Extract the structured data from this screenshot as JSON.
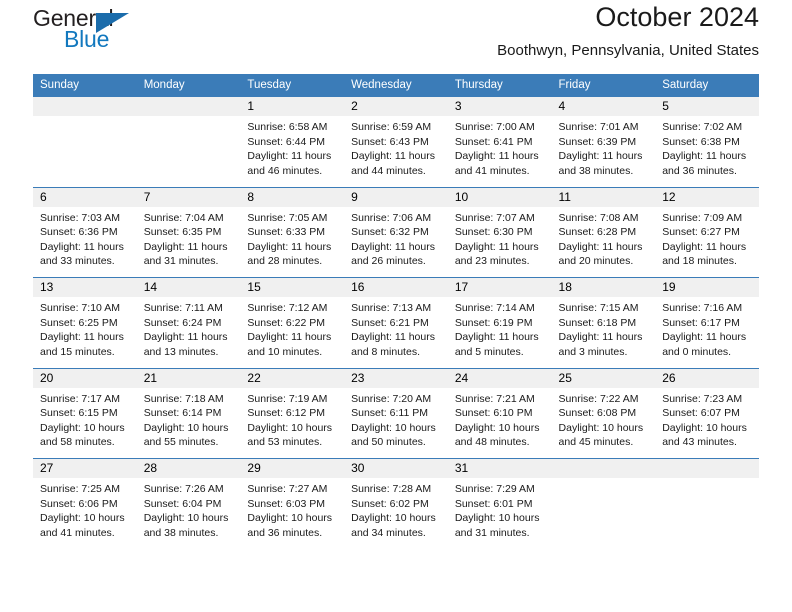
{
  "brand": {
    "name_primary": "General",
    "name_secondary": "Blue",
    "logo_icon": "triangle-icon"
  },
  "header": {
    "title": "October 2024",
    "subtitle": "Boothwyn, Pennsylvania, United States"
  },
  "calendar": {
    "weekday_headers": [
      "Sunday",
      "Monday",
      "Tuesday",
      "Wednesday",
      "Thursday",
      "Friday",
      "Saturday"
    ],
    "weeks": [
      [
        {
          "day": "",
          "sunrise": "",
          "sunset": "",
          "daylight_line1": "",
          "daylight_line2": ""
        },
        {
          "day": "",
          "sunrise": "",
          "sunset": "",
          "daylight_line1": "",
          "daylight_line2": ""
        },
        {
          "day": "1",
          "sunrise": "Sunrise: 6:58 AM",
          "sunset": "Sunset: 6:44 PM",
          "daylight_line1": "Daylight: 11 hours",
          "daylight_line2": "and 46 minutes."
        },
        {
          "day": "2",
          "sunrise": "Sunrise: 6:59 AM",
          "sunset": "Sunset: 6:43 PM",
          "daylight_line1": "Daylight: 11 hours",
          "daylight_line2": "and 44 minutes."
        },
        {
          "day": "3",
          "sunrise": "Sunrise: 7:00 AM",
          "sunset": "Sunset: 6:41 PM",
          "daylight_line1": "Daylight: 11 hours",
          "daylight_line2": "and 41 minutes."
        },
        {
          "day": "4",
          "sunrise": "Sunrise: 7:01 AM",
          "sunset": "Sunset: 6:39 PM",
          "daylight_line1": "Daylight: 11 hours",
          "daylight_line2": "and 38 minutes."
        },
        {
          "day": "5",
          "sunrise": "Sunrise: 7:02 AM",
          "sunset": "Sunset: 6:38 PM",
          "daylight_line1": "Daylight: 11 hours",
          "daylight_line2": "and 36 minutes."
        }
      ],
      [
        {
          "day": "6",
          "sunrise": "Sunrise: 7:03 AM",
          "sunset": "Sunset: 6:36 PM",
          "daylight_line1": "Daylight: 11 hours",
          "daylight_line2": "and 33 minutes."
        },
        {
          "day": "7",
          "sunrise": "Sunrise: 7:04 AM",
          "sunset": "Sunset: 6:35 PM",
          "daylight_line1": "Daylight: 11 hours",
          "daylight_line2": "and 31 minutes."
        },
        {
          "day": "8",
          "sunrise": "Sunrise: 7:05 AM",
          "sunset": "Sunset: 6:33 PM",
          "daylight_line1": "Daylight: 11 hours",
          "daylight_line2": "and 28 minutes."
        },
        {
          "day": "9",
          "sunrise": "Sunrise: 7:06 AM",
          "sunset": "Sunset: 6:32 PM",
          "daylight_line1": "Daylight: 11 hours",
          "daylight_line2": "and 26 minutes."
        },
        {
          "day": "10",
          "sunrise": "Sunrise: 7:07 AM",
          "sunset": "Sunset: 6:30 PM",
          "daylight_line1": "Daylight: 11 hours",
          "daylight_line2": "and 23 minutes."
        },
        {
          "day": "11",
          "sunrise": "Sunrise: 7:08 AM",
          "sunset": "Sunset: 6:28 PM",
          "daylight_line1": "Daylight: 11 hours",
          "daylight_line2": "and 20 minutes."
        },
        {
          "day": "12",
          "sunrise": "Sunrise: 7:09 AM",
          "sunset": "Sunset: 6:27 PM",
          "daylight_line1": "Daylight: 11 hours",
          "daylight_line2": "and 18 minutes."
        }
      ],
      [
        {
          "day": "13",
          "sunrise": "Sunrise: 7:10 AM",
          "sunset": "Sunset: 6:25 PM",
          "daylight_line1": "Daylight: 11 hours",
          "daylight_line2": "and 15 minutes."
        },
        {
          "day": "14",
          "sunrise": "Sunrise: 7:11 AM",
          "sunset": "Sunset: 6:24 PM",
          "daylight_line1": "Daylight: 11 hours",
          "daylight_line2": "and 13 minutes."
        },
        {
          "day": "15",
          "sunrise": "Sunrise: 7:12 AM",
          "sunset": "Sunset: 6:22 PM",
          "daylight_line1": "Daylight: 11 hours",
          "daylight_line2": "and 10 minutes."
        },
        {
          "day": "16",
          "sunrise": "Sunrise: 7:13 AM",
          "sunset": "Sunset: 6:21 PM",
          "daylight_line1": "Daylight: 11 hours",
          "daylight_line2": "and 8 minutes."
        },
        {
          "day": "17",
          "sunrise": "Sunrise: 7:14 AM",
          "sunset": "Sunset: 6:19 PM",
          "daylight_line1": "Daylight: 11 hours",
          "daylight_line2": "and 5 minutes."
        },
        {
          "day": "18",
          "sunrise": "Sunrise: 7:15 AM",
          "sunset": "Sunset: 6:18 PM",
          "daylight_line1": "Daylight: 11 hours",
          "daylight_line2": "and 3 minutes."
        },
        {
          "day": "19",
          "sunrise": "Sunrise: 7:16 AM",
          "sunset": "Sunset: 6:17 PM",
          "daylight_line1": "Daylight: 11 hours",
          "daylight_line2": "and 0 minutes."
        }
      ],
      [
        {
          "day": "20",
          "sunrise": "Sunrise: 7:17 AM",
          "sunset": "Sunset: 6:15 PM",
          "daylight_line1": "Daylight: 10 hours",
          "daylight_line2": "and 58 minutes."
        },
        {
          "day": "21",
          "sunrise": "Sunrise: 7:18 AM",
          "sunset": "Sunset: 6:14 PM",
          "daylight_line1": "Daylight: 10 hours",
          "daylight_line2": "and 55 minutes."
        },
        {
          "day": "22",
          "sunrise": "Sunrise: 7:19 AM",
          "sunset": "Sunset: 6:12 PM",
          "daylight_line1": "Daylight: 10 hours",
          "daylight_line2": "and 53 minutes."
        },
        {
          "day": "23",
          "sunrise": "Sunrise: 7:20 AM",
          "sunset": "Sunset: 6:11 PM",
          "daylight_line1": "Daylight: 10 hours",
          "daylight_line2": "and 50 minutes."
        },
        {
          "day": "24",
          "sunrise": "Sunrise: 7:21 AM",
          "sunset": "Sunset: 6:10 PM",
          "daylight_line1": "Daylight: 10 hours",
          "daylight_line2": "and 48 minutes."
        },
        {
          "day": "25",
          "sunrise": "Sunrise: 7:22 AM",
          "sunset": "Sunset: 6:08 PM",
          "daylight_line1": "Daylight: 10 hours",
          "daylight_line2": "and 45 minutes."
        },
        {
          "day": "26",
          "sunrise": "Sunrise: 7:23 AM",
          "sunset": "Sunset: 6:07 PM",
          "daylight_line1": "Daylight: 10 hours",
          "daylight_line2": "and 43 minutes."
        }
      ],
      [
        {
          "day": "27",
          "sunrise": "Sunrise: 7:25 AM",
          "sunset": "Sunset: 6:06 PM",
          "daylight_line1": "Daylight: 10 hours",
          "daylight_line2": "and 41 minutes."
        },
        {
          "day": "28",
          "sunrise": "Sunrise: 7:26 AM",
          "sunset": "Sunset: 6:04 PM",
          "daylight_line1": "Daylight: 10 hours",
          "daylight_line2": "and 38 minutes."
        },
        {
          "day": "29",
          "sunrise": "Sunrise: 7:27 AM",
          "sunset": "Sunset: 6:03 PM",
          "daylight_line1": "Daylight: 10 hours",
          "daylight_line2": "and 36 minutes."
        },
        {
          "day": "30",
          "sunrise": "Sunrise: 7:28 AM",
          "sunset": "Sunset: 6:02 PM",
          "daylight_line1": "Daylight: 10 hours",
          "daylight_line2": "and 34 minutes."
        },
        {
          "day": "31",
          "sunrise": "Sunrise: 7:29 AM",
          "sunset": "Sunset: 6:01 PM",
          "daylight_line1": "Daylight: 10 hours",
          "daylight_line2": "and 31 minutes."
        },
        {
          "day": "",
          "sunrise": "",
          "sunset": "",
          "daylight_line1": "",
          "daylight_line2": ""
        },
        {
          "day": "",
          "sunrise": "",
          "sunset": "",
          "daylight_line1": "",
          "daylight_line2": ""
        }
      ]
    ]
  },
  "colors": {
    "header_blue": "#3b7cb8",
    "brand_blue": "#1278be",
    "daynum_background": "#f0f0f0"
  }
}
